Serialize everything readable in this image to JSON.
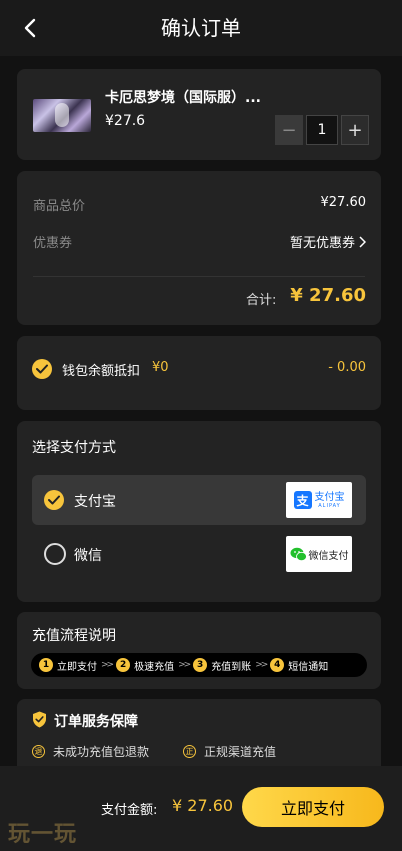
{
  "header": {
    "title": "确认订单"
  },
  "product": {
    "name": "卡厄思梦境（国际服）...",
    "price": "¥27.6",
    "quantity": "1",
    "minus": "−",
    "plus": "+"
  },
  "summary": {
    "subtotal_label": "商品总价",
    "subtotal_value": "¥27.60",
    "coupon_label": "优惠券",
    "coupon_value": "暂无优惠券",
    "total_label": "合计:",
    "total_value": "¥ 27.60"
  },
  "wallet": {
    "label": "钱包余额抵扣",
    "balance": "¥0",
    "deduction": "- 0.00"
  },
  "payment": {
    "title": "选择支付方式",
    "options": [
      {
        "label": "支付宝",
        "selected": true,
        "logo_text": "支付宝",
        "logo_sub": "ALIPAY",
        "logo_mark": "支"
      },
      {
        "label": "微信",
        "selected": false,
        "logo_text": "微信支付"
      }
    ]
  },
  "process": {
    "title": "充值流程说明",
    "steps": [
      {
        "num": "1",
        "label": "立即支付"
      },
      {
        "num": "2",
        "label": "极速充值"
      },
      {
        "num": "3",
        "label": "充值到账"
      },
      {
        "num": "4",
        "label": "短信通知"
      }
    ],
    "arrow": ">>"
  },
  "guarantee": {
    "title": "订单服务保障",
    "items": [
      {
        "icon": "退",
        "label": "未成功充值包退款"
      },
      {
        "icon": "正",
        "label": "正规渠道充值"
      }
    ]
  },
  "footer": {
    "total_label": "支付金额:",
    "total_value": "¥ 27.60",
    "pay_button": "立即支付",
    "watermark": "玩一玩"
  },
  "colors": {
    "accent": "#f7c43c",
    "card": "#232323",
    "background": "#121212",
    "alipay": "#1677ff",
    "wechat": "#22c02c"
  }
}
